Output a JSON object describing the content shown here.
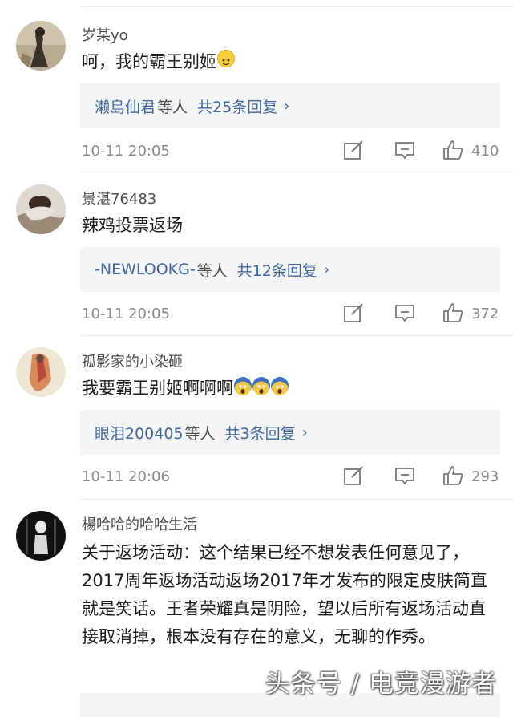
{
  "comments": [
    {
      "username": "岁某yo",
      "text": "呵，我的霸王别姬",
      "reply_names": "濑島仙君",
      "reply_suffix": "等人",
      "reply_count": "共25条回复",
      "time": "10-11 20:05",
      "likes": "410"
    },
    {
      "username": "景湛76483",
      "text": "辣鸡投票返场",
      "reply_names": "-NEWLOOKG-",
      "reply_suffix": "等人",
      "reply_count": "共12条回复",
      "time": "10-11 20:05",
      "likes": "372"
    },
    {
      "username": "孤影家的小染砸",
      "text": "我要霸王别姬啊啊啊",
      "reply_names": "眼泪200405",
      "reply_suffix": "等人",
      "reply_count": "共3条回复",
      "time": "10-11 20:06",
      "likes": "293"
    },
    {
      "username": "楊哈哈的哈哈生活",
      "text": "关于返场活动：这个结果已经不想发表任何意见了，2017周年返场活动返场2017年才发布的限定皮肤简直就是笑话。王者荣耀真是阴险，望以后所有返场活动直接取消掉，根本没有存在的意义，无聊的作秀。"
    }
  ],
  "chevron": "›",
  "watermark": "头条号 / 电竞漫游者",
  "icons": [
    "edit-icon",
    "comment-icon",
    "like-icon",
    "smile-emoji",
    "scream-emoji"
  ],
  "colors": {
    "link": "#406599",
    "reply_bg": "#f4f5f6",
    "meta_text": "#8a8a8a"
  }
}
